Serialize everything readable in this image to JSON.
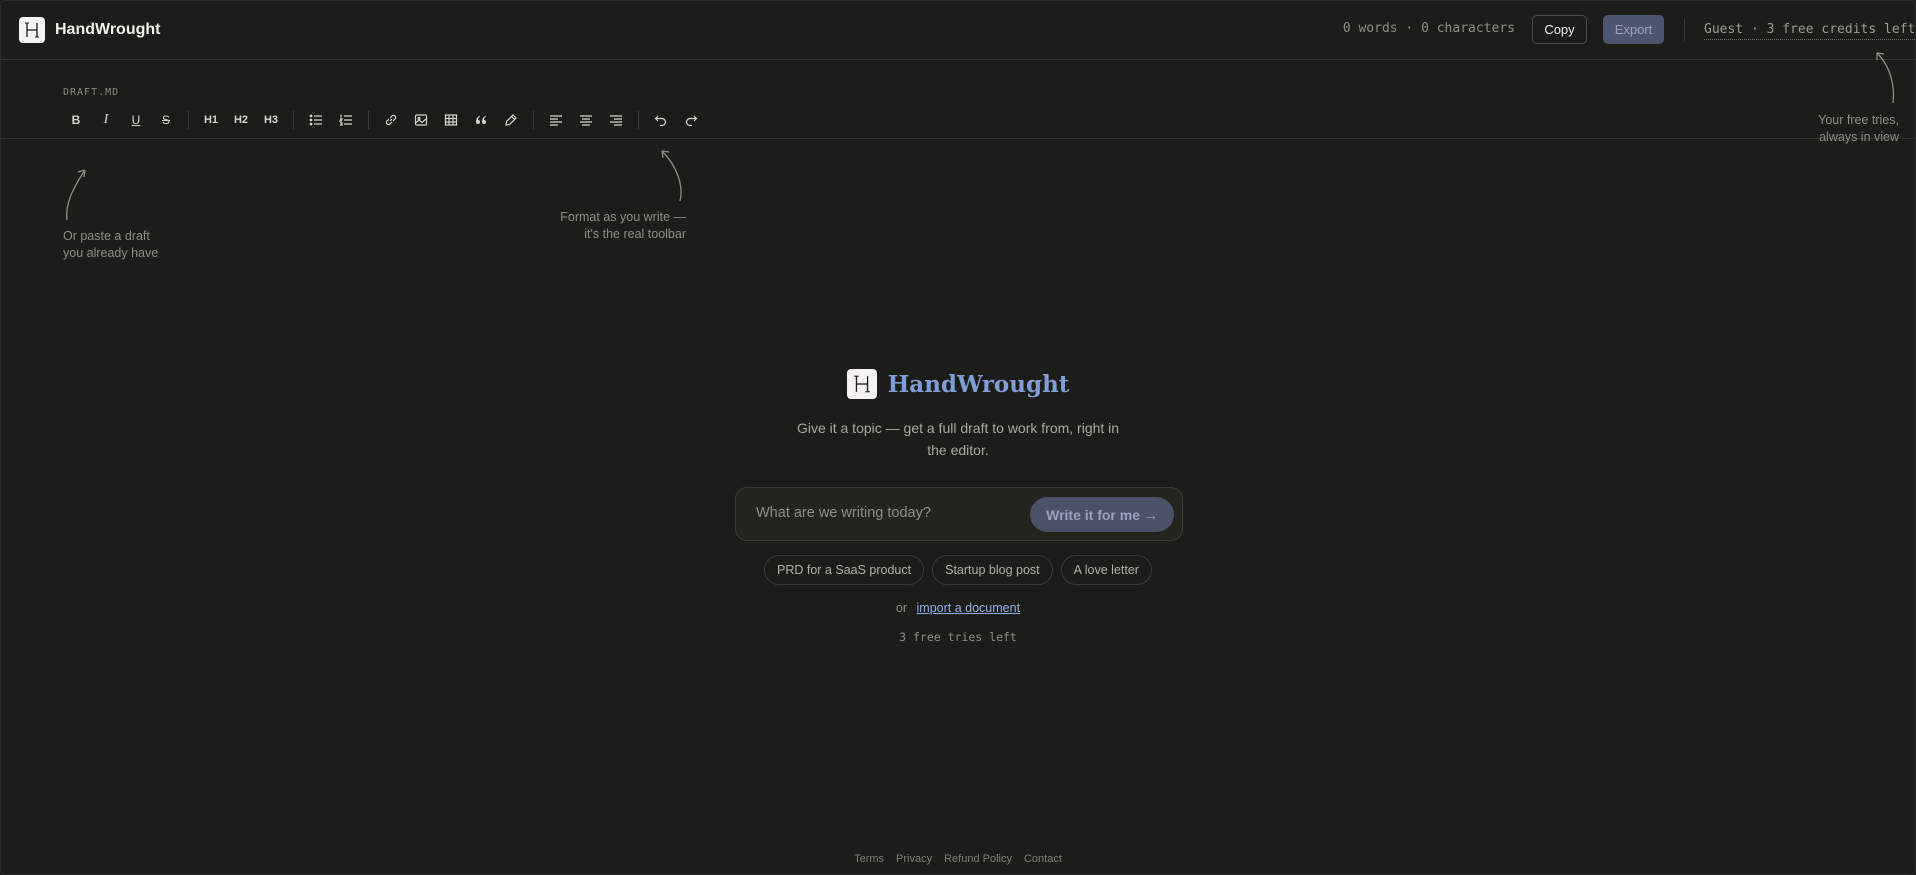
{
  "header": {
    "brand": "HandWrought",
    "stats": "0 words · 0 characters",
    "copy_label": "Copy",
    "export_label": "Export",
    "credits": "Guest · 3 free credits left"
  },
  "editor": {
    "file_label": "DRAFT.MD",
    "toolbar": {
      "bold": "B",
      "italic": "I",
      "underline": "U",
      "strike": "S",
      "h1": "H1",
      "h2": "H2",
      "h3": "H3"
    }
  },
  "annotations": {
    "paste_line1": "Or paste a draft",
    "paste_line2": "you already have",
    "format_line1": "Format as you write —",
    "format_line2": "it's the real toolbar",
    "credits_line1": "Your free tries,",
    "credits_line2": "always in view"
  },
  "hero": {
    "title": "HandWrought",
    "subtitle": "Give it a topic — get a full draft to work from, right in the editor.",
    "prompt_placeholder": "What are we writing today?",
    "write_button": "Write it for me →",
    "chips": [
      "PRD for a SaaS product",
      "Startup blog post",
      "A love letter"
    ],
    "import_prefix": "or",
    "import_link": "import a document",
    "tries_left": "3 free tries left"
  },
  "footer": {
    "links": [
      "Terms",
      "Privacy",
      "Refund Policy",
      "Contact"
    ]
  },
  "colors": {
    "background": "#1c1c19",
    "accent": "#7f9ed8",
    "button_disabled": "#4d5670"
  },
  "icons": [
    "logo-icon",
    "bullet-list-icon",
    "numbered-list-icon",
    "link-icon",
    "image-icon",
    "table-icon",
    "quote-icon",
    "highlighter-icon",
    "align-left-icon",
    "align-center-icon",
    "align-right-icon",
    "undo-icon",
    "redo-icon"
  ]
}
